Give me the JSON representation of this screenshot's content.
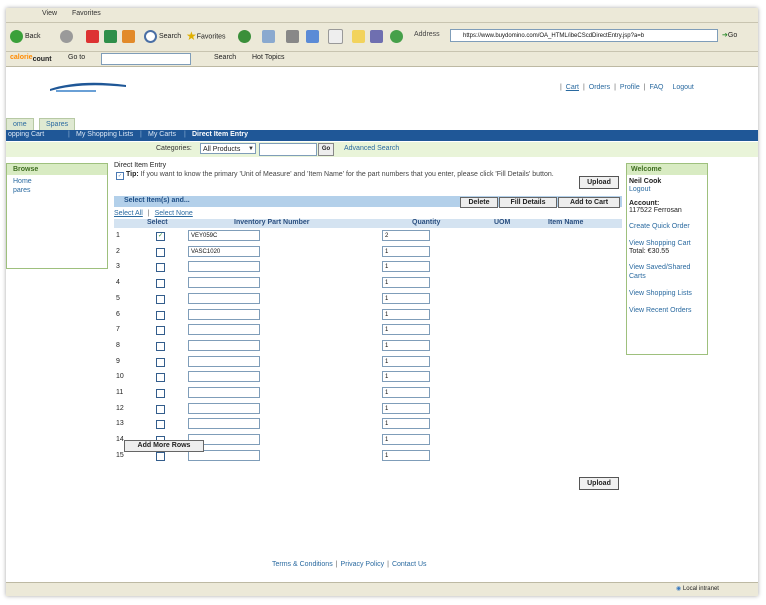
{
  "browser": {
    "menu": [
      "View",
      "Favorites"
    ],
    "toolbar": {
      "back": "Back",
      "search": "Search",
      "favorites": "Favorites",
      "address_label": "Address",
      "address_value": "https://www.buydomino.com/OA_HTML/ibeCScdDirectEntry.jsp?a=b",
      "go": "Go"
    },
    "toolbar2": {
      "logo_prefix": "calorie",
      "logo_suffix": "count",
      "goto": "Go to",
      "search": "Search",
      "hot_topics": "Hot Topics"
    },
    "status": {
      "zone": "Local intranet"
    }
  },
  "header": {
    "links": [
      "Cart",
      "Orders",
      "Profile",
      "FAQ",
      "Logout"
    ]
  },
  "tabs": [
    "ome",
    "Spares"
  ],
  "nav": [
    "opping Cart",
    "My Shopping Lists",
    "My Carts",
    "Direct Item Entry"
  ],
  "searchbar": {
    "categories_label": "Categories:",
    "category_value": "All Products",
    "go": "Go",
    "advanced": "Advanced Search"
  },
  "browse": {
    "title": "Browse",
    "items": [
      "Home",
      "pares"
    ]
  },
  "welcome": {
    "title": "Welcome",
    "name": "Neil Cook",
    "logout": "Logout",
    "account_label": "Account:",
    "account_value": "117522 Ferrosan",
    "links": [
      "Create Quick Order",
      "View Shopping Cart"
    ],
    "total": "Total: €30.55",
    "links2": [
      "View Saved/Shared Carts",
      "View Shopping Lists",
      "View Recent Orders"
    ]
  },
  "main": {
    "title": "Direct Item Entry",
    "tip_bold": "Tip:",
    "tip_text": "If you want to know the primary 'Unit of Measure' and 'Item Name' for the part numbers that you enter, please click 'Fill Details' button.",
    "upload": "Upload",
    "select_title": "Select Item(s) and...",
    "delete": "Delete",
    "fill_details": "Fill Details",
    "add_to_cart": "Add to Cart",
    "select_all": "Select All",
    "select_none": "Select None",
    "columns": [
      "Select",
      "Inventory Part Number",
      "Quantity",
      "UOM",
      "Item Name"
    ],
    "rows": [
      {
        "n": "1",
        "checked": true,
        "part": "VEY059C",
        "qty": "2"
      },
      {
        "n": "2",
        "checked": false,
        "part": "VASC1020",
        "qty": "1"
      },
      {
        "n": "3",
        "checked": false,
        "part": "",
        "qty": "1"
      },
      {
        "n": "4",
        "checked": false,
        "part": "",
        "qty": "1"
      },
      {
        "n": "5",
        "checked": false,
        "part": "",
        "qty": "1"
      },
      {
        "n": "6",
        "checked": false,
        "part": "",
        "qty": "1"
      },
      {
        "n": "7",
        "checked": false,
        "part": "",
        "qty": "1"
      },
      {
        "n": "8",
        "checked": false,
        "part": "",
        "qty": "1"
      },
      {
        "n": "9",
        "checked": false,
        "part": "",
        "qty": "1"
      },
      {
        "n": "10",
        "checked": false,
        "part": "",
        "qty": "1"
      },
      {
        "n": "11",
        "checked": false,
        "part": "",
        "qty": "1"
      },
      {
        "n": "12",
        "checked": false,
        "part": "",
        "qty": "1"
      },
      {
        "n": "13",
        "checked": false,
        "part": "",
        "qty": "1"
      },
      {
        "n": "14",
        "checked": false,
        "part": "",
        "qty": "1"
      },
      {
        "n": "15",
        "checked": false,
        "part": "",
        "qty": "1"
      }
    ],
    "add_more_rows": "Add More Rows"
  },
  "footer": [
    "Terms & Conditions",
    "Privacy Policy",
    "Contact Us"
  ]
}
